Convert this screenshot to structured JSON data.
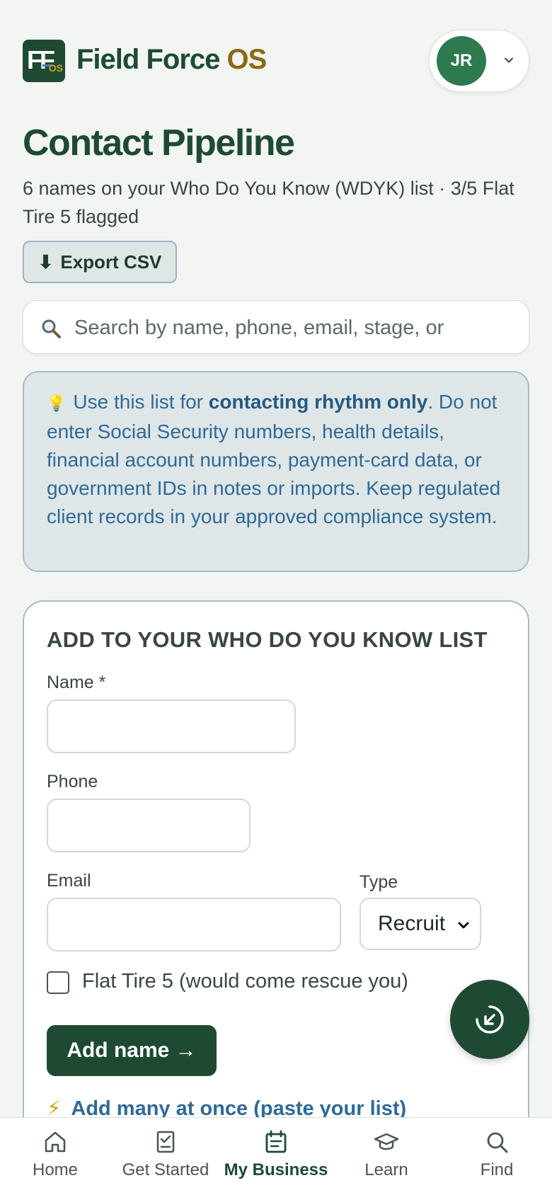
{
  "header": {
    "brand_main": "Field Force",
    "brand_accent": "OS",
    "logo_letters": "FF",
    "logo_sub": "OS",
    "avatar_initials": "JR"
  },
  "page": {
    "title": "Contact Pipeline",
    "subtitle": "6 names on your Who Do You Know (WDYK) list · 3/5 Flat Tire 5 flagged",
    "export_label": "Export CSV",
    "export_icon": "⬇"
  },
  "search": {
    "placeholder": "Search by name, phone, email, stage, or",
    "value": ""
  },
  "notice": {
    "icon": "💡",
    "text_before": "Use this list for ",
    "text_strong": "contacting rhythm only",
    "text_after": ". Do not enter Social Security numbers, health details, financial account numbers, payment-card data, or government IDs in notes or imports. Keep regulated client records in your approved compliance system."
  },
  "form": {
    "heading": "ADD TO YOUR WHO DO YOU KNOW LIST",
    "name_label": "Name *",
    "name_value": "",
    "phone_label": "Phone",
    "phone_value": "",
    "email_label": "Email",
    "email_value": "",
    "type_label": "Type",
    "type_selected": "Recruit",
    "checkbox_label": "Flat Tire 5 (would come rescue you)",
    "checkbox_checked": false,
    "add_button": "Add name →",
    "paste_icon": "⚡",
    "paste_link": "Add many at once (paste your list)"
  },
  "nav": {
    "items": [
      {
        "label": "Home",
        "icon": "home-icon"
      },
      {
        "label": "Get Started",
        "icon": "checklist-icon"
      },
      {
        "label": "My Business",
        "icon": "calendar-icon",
        "active": true
      },
      {
        "label": "Learn",
        "icon": "graduation-cap-icon"
      },
      {
        "label": "Find",
        "icon": "search-icon"
      }
    ]
  },
  "colors": {
    "brand_green": "#1e4a34",
    "brand_gold": "#8a6a14",
    "info_blue": "#2f6a96",
    "avatar_green": "#2c7a4e"
  }
}
